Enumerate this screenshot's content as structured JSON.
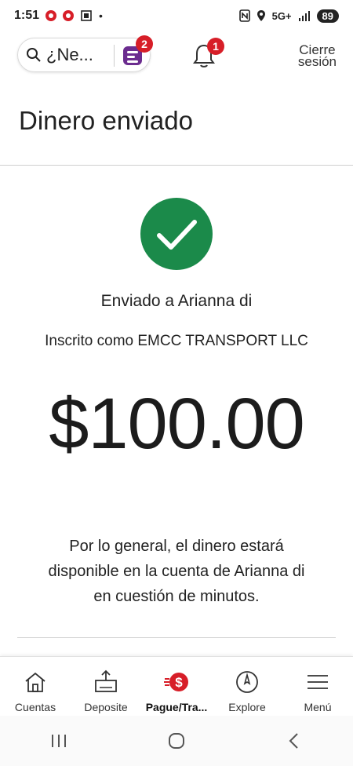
{
  "status_bar": {
    "time": "1:51",
    "dot": "•",
    "network": "5G+",
    "battery": "89"
  },
  "header": {
    "search_text": "¿Ne...",
    "inbox_badge": "2",
    "bell_badge": "1",
    "logout_line1": "Cierre",
    "logout_line2": "sesión"
  },
  "page": {
    "title": "Dinero enviado",
    "sent_to": "Enviado a Arianna di",
    "enrolled_as": "Inscrito como EMCC TRANSPORT LLC",
    "amount": "$100.00",
    "availability_line1": "Por lo general, el dinero estará",
    "availability_line2": "disponible en la cuenta de Arianna di",
    "availability_line3": "en cuestión de minutos."
  },
  "bottom_nav": {
    "items": [
      {
        "label": "Cuentas",
        "icon": "house-icon"
      },
      {
        "label": "Deposite",
        "icon": "deposit-icon"
      },
      {
        "label": "Pague/Tra...",
        "icon": "pay-transfer-icon",
        "active": true
      },
      {
        "label": "Explore",
        "icon": "compass-icon"
      },
      {
        "label": "Menú",
        "icon": "hamburger-menu-icon"
      }
    ]
  },
  "colors": {
    "brand_red": "#d71e28",
    "success_green": "#1b8a4a",
    "inbox_purple": "#6b2c8f"
  }
}
